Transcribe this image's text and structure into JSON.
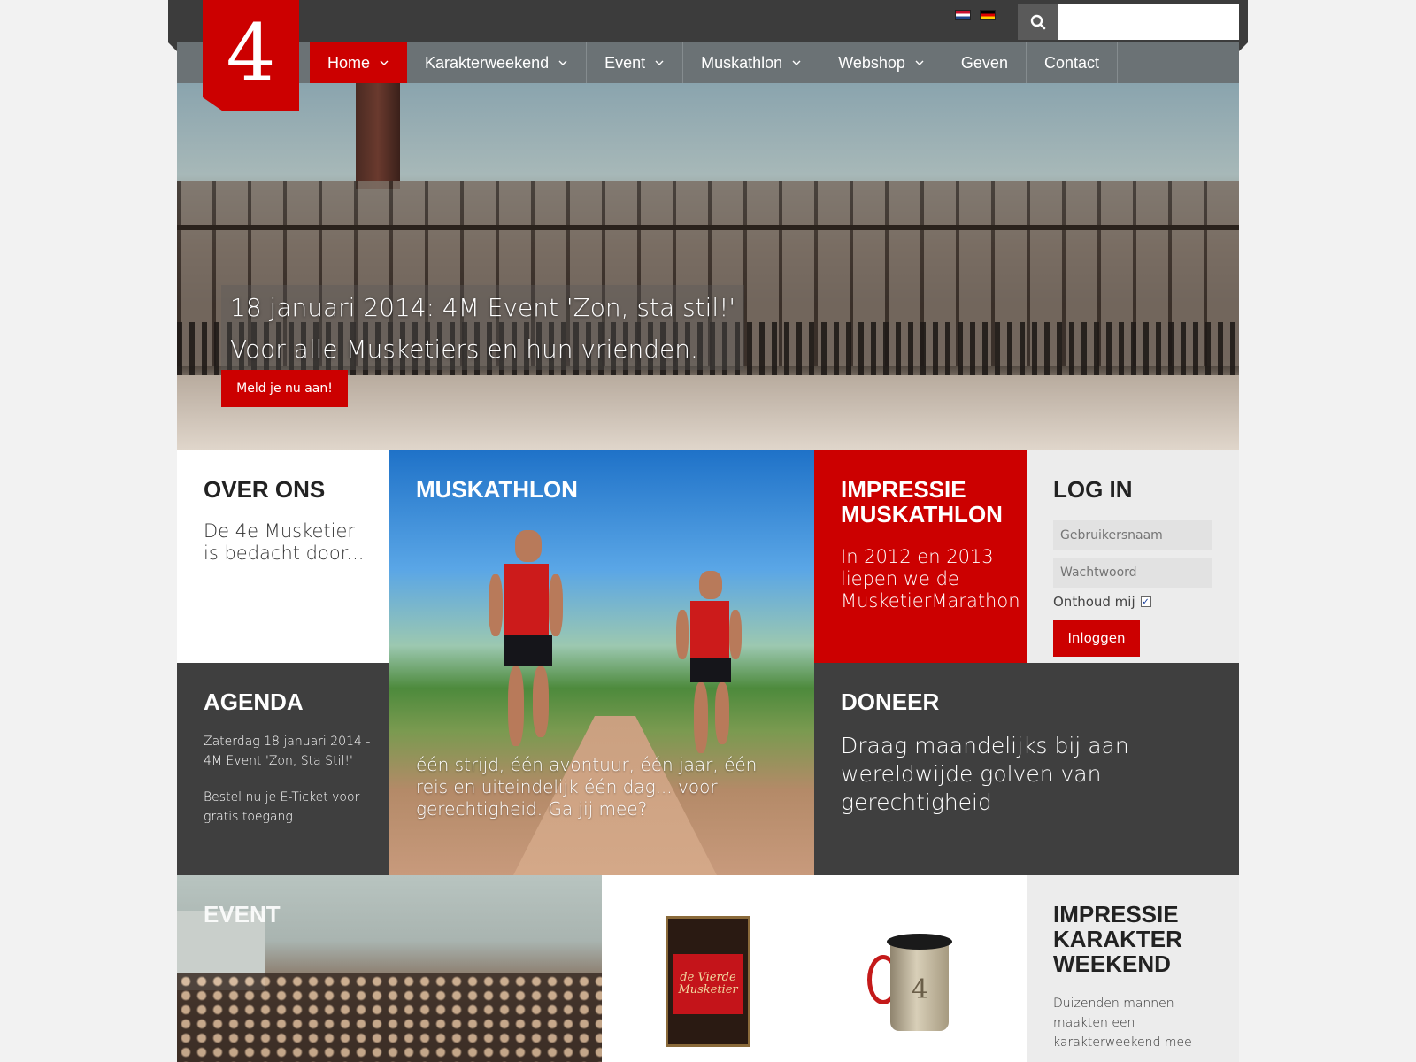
{
  "header": {
    "logo_text": "4",
    "search_placeholder": ""
  },
  "nav": {
    "items": [
      {
        "label": "Home",
        "has_dropdown": true,
        "active": true
      },
      {
        "label": "Karakterweekend",
        "has_dropdown": true,
        "active": false
      },
      {
        "label": "Event",
        "has_dropdown": true,
        "active": false
      },
      {
        "label": "Muskathlon",
        "has_dropdown": true,
        "active": false
      },
      {
        "label": "Webshop",
        "has_dropdown": true,
        "active": false
      },
      {
        "label": "Geven",
        "has_dropdown": false,
        "active": false
      },
      {
        "label": "Contact",
        "has_dropdown": false,
        "active": false
      }
    ]
  },
  "hero": {
    "line1": "18 januari 2014: 4M Event 'Zon, sta stil!'",
    "line2": "Voor alle Musketiers en hun vrienden.",
    "button": "Meld je nu aan!"
  },
  "tiles": {
    "overons": {
      "title": "OVER ONS",
      "text": "De 4e Musketier is bedacht door..."
    },
    "muskathlon": {
      "title": "MUSKATHLON",
      "text": "één strijd, één avontuur, één jaar, één reis en uiteindelijk één dag... voor gerechtigheid. Ga jij mee?"
    },
    "impressie_musk": {
      "title_line1": "IMPRESSIE",
      "title_line2": "MUSKATHLON",
      "text": "In 2012 en 2013 liepen we de MusketierMarathon"
    },
    "login": {
      "title": "LOG IN",
      "username_placeholder": "Gebruikersnaam",
      "password_placeholder": "Wachtwoord",
      "remember": "Onthoud mij",
      "button": "Inloggen"
    },
    "agenda": {
      "title": "AGENDA",
      "line1": "Zaterdag 18 januari 2014 - 4M Event 'Zon, Sta Stil!'",
      "line2": "Bestel nu je E-Ticket voor gratis toegang."
    },
    "doneer": {
      "title": "DONEER",
      "text": "Draag maandelijks bij aan wereldwijde golven van gerechtigheid"
    },
    "event": {
      "title": "EVENT"
    },
    "webshop": {
      "book_title": "de Vierde Musketier",
      "mug_number": "4"
    },
    "impressie_karakter": {
      "title_line1": "IMPRESSIE",
      "title_line2": "KARAKTER",
      "title_line3": "WEEKEND",
      "text": "Duizenden mannen maakten een karakterweekend mee"
    }
  },
  "colors": {
    "accent": "#cc0000",
    "dark": "#3f3f3f",
    "nav": "#6b7275"
  }
}
